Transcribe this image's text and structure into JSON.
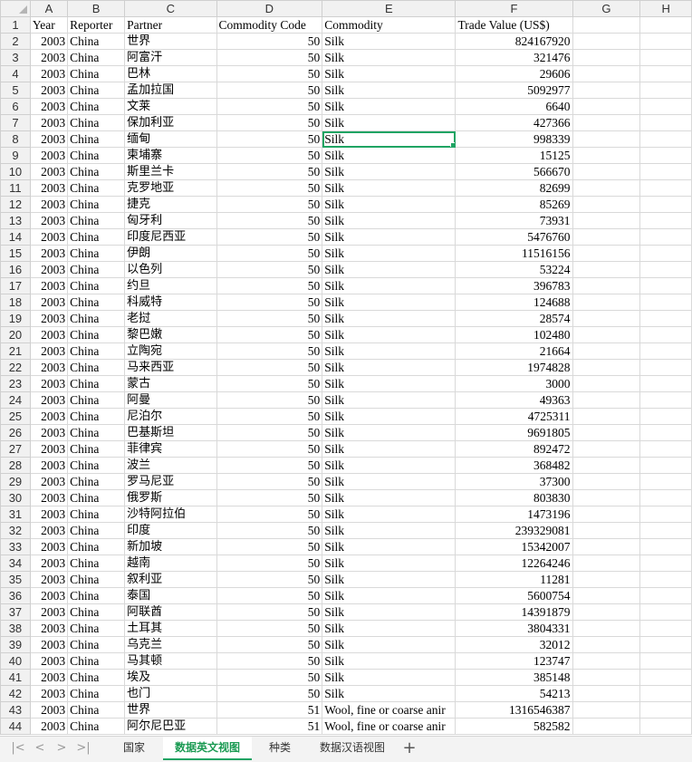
{
  "columns": [
    "A",
    "B",
    "C",
    "D",
    "E",
    "F",
    "G",
    "H"
  ],
  "selected_column": "E",
  "selected_row": "8",
  "headers": [
    "Year",
    "Reporter",
    "Partner",
    "Commodity Code",
    "Commodity",
    "Trade Value (US$)"
  ],
  "rows": [
    [
      "2",
      "2003",
      "China",
      "世界",
      "50",
      "Silk",
      "824167920"
    ],
    [
      "3",
      "2003",
      "China",
      "阿富汗",
      "50",
      "Silk",
      "321476"
    ],
    [
      "4",
      "2003",
      "China",
      "巴林",
      "50",
      "Silk",
      "29606"
    ],
    [
      "5",
      "2003",
      "China",
      "孟加拉国",
      "50",
      "Silk",
      "5092977"
    ],
    [
      "6",
      "2003",
      "China",
      "文莱",
      "50",
      "Silk",
      "6640"
    ],
    [
      "7",
      "2003",
      "China",
      "保加利亚",
      "50",
      "Silk",
      "427366"
    ],
    [
      "8",
      "2003",
      "China",
      "缅甸",
      "50",
      "Silk",
      "998339"
    ],
    [
      "9",
      "2003",
      "China",
      "柬埔寨",
      "50",
      "Silk",
      "15125"
    ],
    [
      "10",
      "2003",
      "China",
      "斯里兰卡",
      "50",
      "Silk",
      "566670"
    ],
    [
      "11",
      "2003",
      "China",
      "克罗地亚",
      "50",
      "Silk",
      "82699"
    ],
    [
      "12",
      "2003",
      "China",
      "捷克",
      "50",
      "Silk",
      "85269"
    ],
    [
      "13",
      "2003",
      "China",
      "匈牙利",
      "50",
      "Silk",
      "73931"
    ],
    [
      "14",
      "2003",
      "China",
      "印度尼西亚",
      "50",
      "Silk",
      "5476760"
    ],
    [
      "15",
      "2003",
      "China",
      "伊朗",
      "50",
      "Silk",
      "11516156"
    ],
    [
      "16",
      "2003",
      "China",
      "以色列",
      "50",
      "Silk",
      "53224"
    ],
    [
      "17",
      "2003",
      "China",
      "约旦",
      "50",
      "Silk",
      "396783"
    ],
    [
      "18",
      "2003",
      "China",
      "科威特",
      "50",
      "Silk",
      "124688"
    ],
    [
      "19",
      "2003",
      "China",
      "老挝",
      "50",
      "Silk",
      "28574"
    ],
    [
      "20",
      "2003",
      "China",
      "黎巴嫩",
      "50",
      "Silk",
      "102480"
    ],
    [
      "21",
      "2003",
      "China",
      "立陶宛",
      "50",
      "Silk",
      "21664"
    ],
    [
      "22",
      "2003",
      "China",
      "马来西亚",
      "50",
      "Silk",
      "1974828"
    ],
    [
      "23",
      "2003",
      "China",
      "蒙古",
      "50",
      "Silk",
      "3000"
    ],
    [
      "24",
      "2003",
      "China",
      "阿曼",
      "50",
      "Silk",
      "49363"
    ],
    [
      "25",
      "2003",
      "China",
      "尼泊尔",
      "50",
      "Silk",
      "4725311"
    ],
    [
      "26",
      "2003",
      "China",
      "巴基斯坦",
      "50",
      "Silk",
      "9691805"
    ],
    [
      "27",
      "2003",
      "China",
      "菲律宾",
      "50",
      "Silk",
      "892472"
    ],
    [
      "28",
      "2003",
      "China",
      "波兰",
      "50",
      "Silk",
      "368482"
    ],
    [
      "29",
      "2003",
      "China",
      "罗马尼亚",
      "50",
      "Silk",
      "37300"
    ],
    [
      "30",
      "2003",
      "China",
      "俄罗斯",
      "50",
      "Silk",
      "803830"
    ],
    [
      "31",
      "2003",
      "China",
      "沙特阿拉伯",
      "50",
      "Silk",
      "1473196"
    ],
    [
      "32",
      "2003",
      "China",
      "印度",
      "50",
      "Silk",
      "239329081"
    ],
    [
      "33",
      "2003",
      "China",
      "新加坡",
      "50",
      "Silk",
      "15342007"
    ],
    [
      "34",
      "2003",
      "China",
      "越南",
      "50",
      "Silk",
      "12264246"
    ],
    [
      "35",
      "2003",
      "China",
      "叙利亚",
      "50",
      "Silk",
      "11281"
    ],
    [
      "36",
      "2003",
      "China",
      "泰国",
      "50",
      "Silk",
      "5600754"
    ],
    [
      "37",
      "2003",
      "China",
      "阿联酋",
      "50",
      "Silk",
      "14391879"
    ],
    [
      "38",
      "2003",
      "China",
      "土耳其",
      "50",
      "Silk",
      "3804331"
    ],
    [
      "39",
      "2003",
      "China",
      "乌克兰",
      "50",
      "Silk",
      "32012"
    ],
    [
      "40",
      "2003",
      "China",
      "马其顿",
      "50",
      "Silk",
      "123747"
    ],
    [
      "41",
      "2003",
      "China",
      "埃及",
      "50",
      "Silk",
      "385148"
    ],
    [
      "42",
      "2003",
      "China",
      "也门",
      "50",
      "Silk",
      "54213"
    ],
    [
      "43",
      "2003",
      "China",
      "世界",
      "51",
      "Wool, fine or coarse anir",
      "1316546387"
    ],
    [
      "44",
      "2003",
      "China",
      "阿尔尼巴亚",
      "51",
      "Wool, fine or coarse anir",
      "582582"
    ]
  ],
  "tabs": [
    "国家",
    "数据英文视图",
    "种类",
    "数据汉语视图"
  ],
  "active_tab": "数据英文视图",
  "nav": [
    "|<",
    "<",
    ">",
    ">|"
  ],
  "add_tab": "+"
}
